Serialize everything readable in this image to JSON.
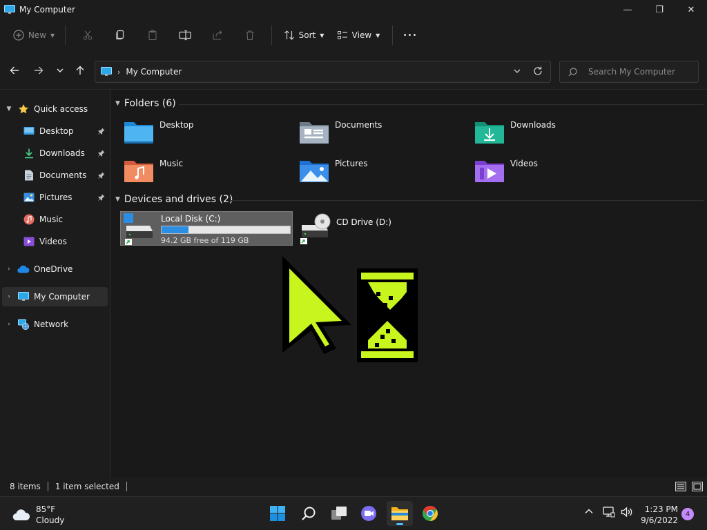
{
  "window": {
    "title": "My Computer",
    "minimize_glyph": "—",
    "restore_glyph": "❐",
    "close_glyph": "✕"
  },
  "commandbar": {
    "new_label": "New",
    "sort_label": "Sort",
    "view_label": "View",
    "more_glyph": "•••"
  },
  "nav": {
    "path_label": "My Computer",
    "search_placeholder": "Search My Computer"
  },
  "sidebar": {
    "items": [
      {
        "label": "Quick access",
        "icon": "star-icon"
      },
      {
        "label": "Desktop",
        "icon": "desktop-icon",
        "pinned": true
      },
      {
        "label": "Downloads",
        "icon": "download-icon",
        "pinned": true
      },
      {
        "label": "Documents",
        "icon": "document-icon",
        "pinned": true
      },
      {
        "label": "Pictures",
        "icon": "pictures-icon",
        "pinned": true
      },
      {
        "label": "Music",
        "icon": "music-icon"
      },
      {
        "label": "Videos",
        "icon": "video-icon"
      },
      {
        "label": "OneDrive",
        "icon": "cloud-icon"
      },
      {
        "label": "My Computer",
        "icon": "monitor-icon",
        "selected": true
      },
      {
        "label": "Network",
        "icon": "network-icon"
      }
    ]
  },
  "main": {
    "folders_header": "Folders (6)",
    "folders": [
      {
        "name": "Desktop",
        "icon": "desktop-folder-icon"
      },
      {
        "name": "Documents",
        "icon": "documents-folder-icon"
      },
      {
        "name": "Downloads",
        "icon": "downloads-folder-icon"
      },
      {
        "name": "Music",
        "icon": "music-folder-icon"
      },
      {
        "name": "Pictures",
        "icon": "pictures-folder-icon"
      },
      {
        "name": "Videos",
        "icon": "videos-folder-icon"
      }
    ],
    "drives_header": "Devices and drives (2)",
    "drives": [
      {
        "name": "Local Disk (C:)",
        "free_text": "94.2 GB free of 119 GB",
        "used_fraction": 0.21,
        "selected": true
      },
      {
        "name": "CD Drive (D:)"
      }
    ]
  },
  "statusbar": {
    "item_count": "8 items",
    "selection": "1 item selected"
  },
  "taskbar": {
    "temperature": "85°F",
    "condition": "Cloudy",
    "time": "1:23 PM",
    "date": "9/6/2022",
    "notification_count": "4"
  },
  "colors": {
    "accent": "#4cc2ff",
    "cursor_overlay": "#c8f51e",
    "drive_bar": "#2b8ee3"
  }
}
